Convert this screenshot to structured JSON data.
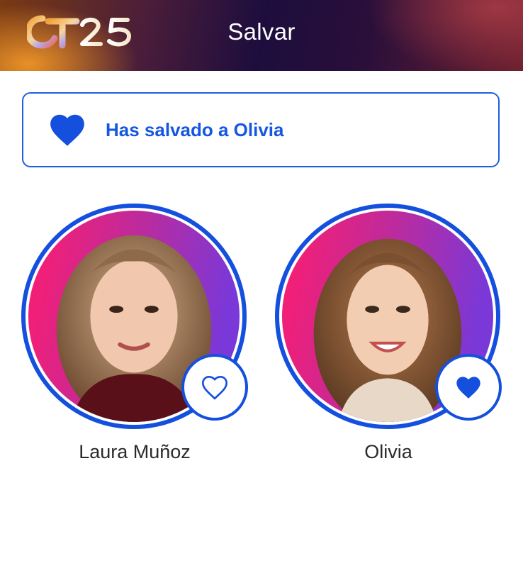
{
  "header": {
    "logo_text": "OT25",
    "title": "Salvar"
  },
  "banner": {
    "icon": "heart-filled-icon",
    "message": "Has salvado a Olivia"
  },
  "candidates": [
    {
      "name": "Laura Muñoz",
      "saved": false,
      "heart_icon": "heart-outline-icon"
    },
    {
      "name": "Olivia",
      "saved": true,
      "heart_icon": "heart-filled-icon"
    }
  ],
  "colors": {
    "accent_blue": "#1450dd",
    "banner_text": "#1557e0"
  }
}
